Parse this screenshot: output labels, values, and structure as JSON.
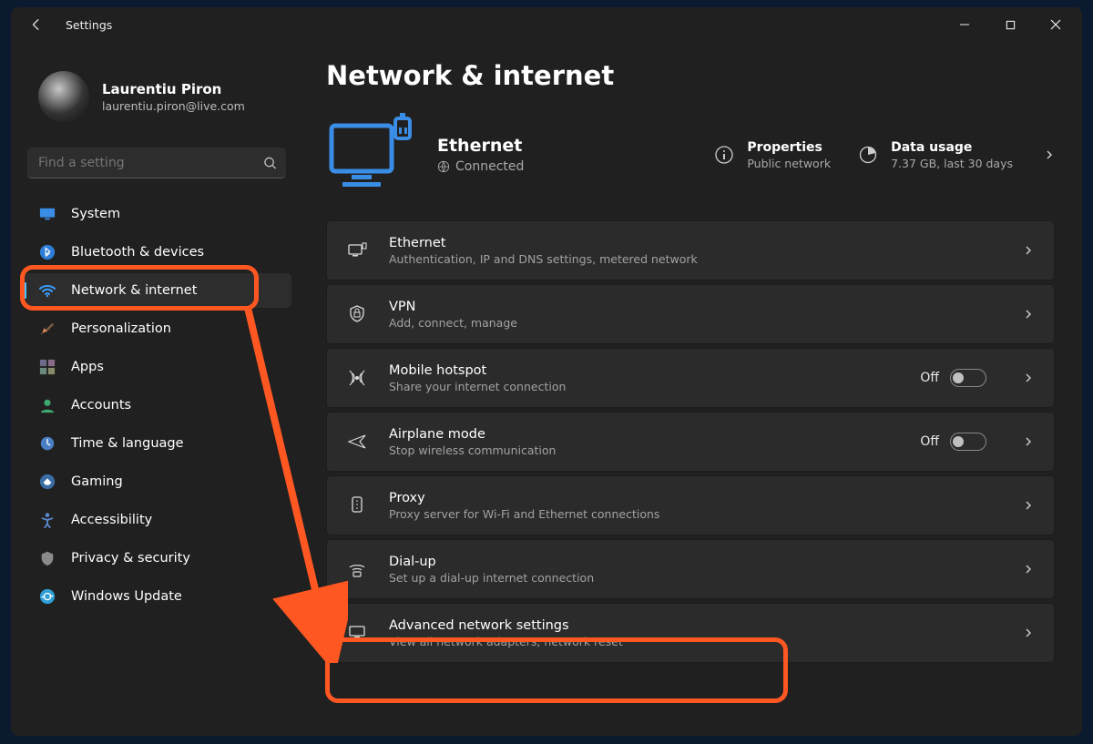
{
  "titlebar": {
    "title": "Settings"
  },
  "profile": {
    "name": "Laurentiu Piron",
    "email": "laurentiu.piron@live.com"
  },
  "search": {
    "placeholder": "Find a setting"
  },
  "sidebar": {
    "items": [
      {
        "label": "System"
      },
      {
        "label": "Bluetooth & devices"
      },
      {
        "label": "Network & internet"
      },
      {
        "label": "Personalization"
      },
      {
        "label": "Apps"
      },
      {
        "label": "Accounts"
      },
      {
        "label": "Time & language"
      },
      {
        "label": "Gaming"
      },
      {
        "label": "Accessibility"
      },
      {
        "label": "Privacy & security"
      },
      {
        "label": "Windows Update"
      }
    ]
  },
  "page": {
    "title": "Network & internet",
    "hero": {
      "conn_title": "Ethernet",
      "conn_status": "Connected",
      "props_title": "Properties",
      "props_sub": "Public network",
      "usage_title": "Data usage",
      "usage_sub": "7.37 GB, last 30 days"
    },
    "rows": [
      {
        "title": "Ethernet",
        "sub": "Authentication, IP and DNS settings, metered network"
      },
      {
        "title": "VPN",
        "sub": "Add, connect, manage"
      },
      {
        "title": "Mobile hotspot",
        "sub": "Share your internet connection",
        "toggle": "Off"
      },
      {
        "title": "Airplane mode",
        "sub": "Stop wireless communication",
        "toggle": "Off"
      },
      {
        "title": "Proxy",
        "sub": "Proxy server for Wi-Fi and Ethernet connections"
      },
      {
        "title": "Dial-up",
        "sub": "Set up a dial-up internet connection"
      },
      {
        "title": "Advanced network settings",
        "sub": "View all network adapters, network reset"
      }
    ]
  }
}
